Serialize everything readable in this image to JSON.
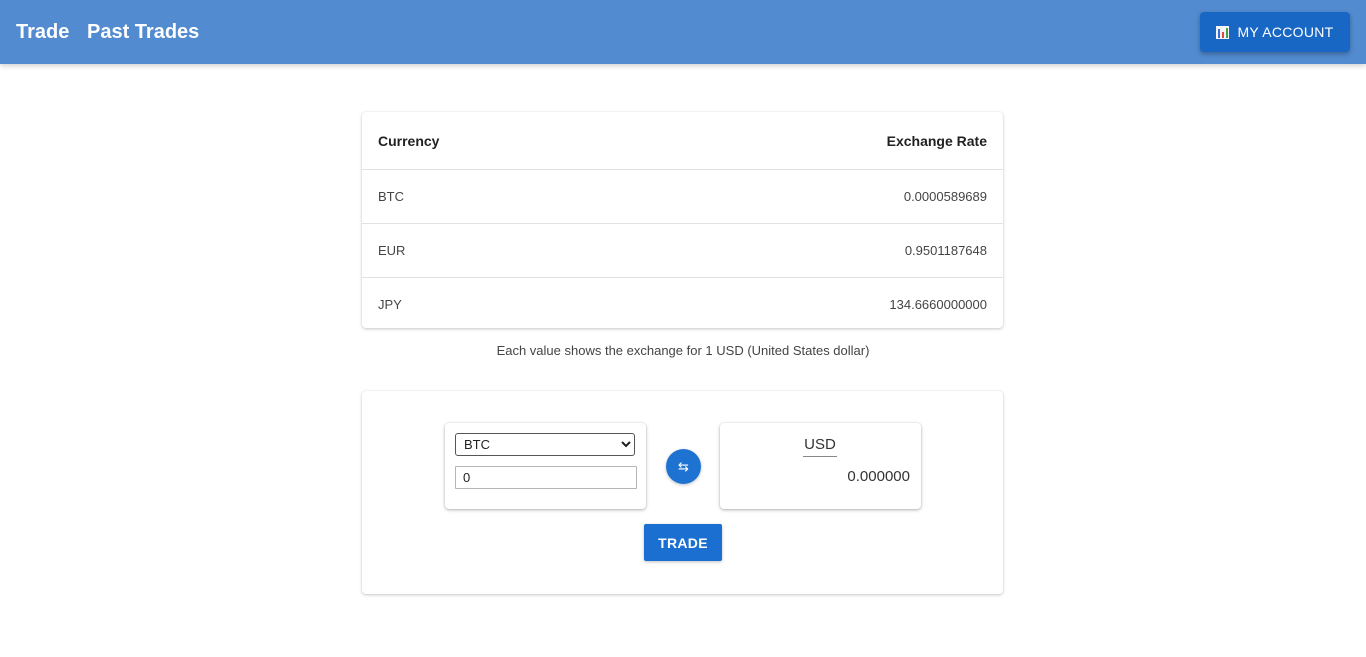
{
  "nav": {
    "trade_label": "Trade",
    "past_trades_label": "Past Trades",
    "account_label": "MY ACCOUNT",
    "account_icon": "bar-chart-icon"
  },
  "rates": {
    "headers": [
      "Currency",
      "Exchange Rate"
    ],
    "rows": [
      [
        "BTC",
        "0.0000589689"
      ],
      [
        "EUR",
        "0.9501187648"
      ],
      [
        "JPY",
        "134.6660000000"
      ]
    ],
    "note": "Each value shows the exchange for 1 USD (United States dollar)"
  },
  "trade": {
    "from_currency": "BTC",
    "from_amount": "0",
    "swap_icon": "swap-arrows-icon",
    "to_currency": "USD",
    "to_amount": "0.000000",
    "button_label": "TRADE"
  },
  "colors": {
    "topbar": "#528bd0",
    "accent": "#1a6fd0"
  }
}
